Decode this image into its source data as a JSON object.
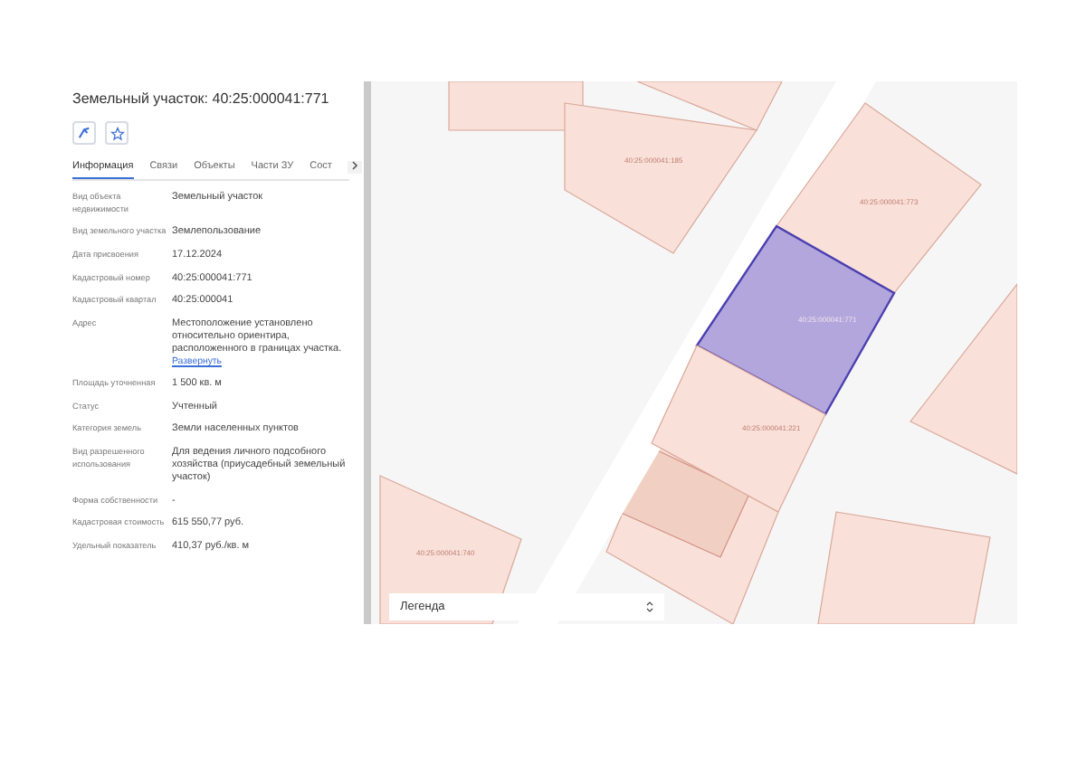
{
  "title": "Земельный участок: 40:25:000041:771",
  "actions": [
    {
      "kind": "locate"
    },
    {
      "kind": "favorite"
    }
  ],
  "tabs": [
    {
      "label": "Информация",
      "selected": true
    },
    {
      "label": "Связи",
      "selected": false
    },
    {
      "label": "Объекты",
      "selected": false
    },
    {
      "label": "Части ЗУ",
      "selected": false
    },
    {
      "label": "Сост",
      "selected": false
    }
  ],
  "fields": [
    {
      "label": "Вид объекта недвижимости",
      "value": "Земельный участок"
    },
    {
      "label": "Вид земельного участка",
      "value": "Землепользование"
    },
    {
      "label": "Дата присвоения",
      "value": "17.12.2024"
    },
    {
      "label": "Кадастровый номер",
      "value": "40:25:000041:771"
    },
    {
      "label": "Кадастровый квартал",
      "value": "40:25:000041"
    },
    {
      "label": "Адрес",
      "value": "Местоположение установлено относительно ориентира, расположенного в границах участка.",
      "link": "Развернуть"
    },
    {
      "label": "Площадь уточненная",
      "value": "1 500 кв. м"
    },
    {
      "label": "Статус",
      "value": "Учтенный"
    },
    {
      "label": "Категория земель",
      "value": "Земли населенных пунктов"
    },
    {
      "label": "Вид разрешенного использования",
      "value": "Для ведения личного подсобного хозяйства (приусадебный земельный участок)"
    },
    {
      "label": "Форма собственности",
      "value": "-"
    },
    {
      "label": "Кадастровая стоимость",
      "value": "615 550,77 руб."
    },
    {
      "label": "Удельный показатель",
      "value": "410,37 руб./кв. м"
    }
  ],
  "map": {
    "parcels": [
      {
        "label": "40:25:000041:185",
        "selected": false
      },
      {
        "label": "40:25:000041:773",
        "selected": false
      },
      {
        "label": "40:25:000041:771",
        "selected": true
      },
      {
        "label": "40:25:000041:221",
        "selected": false
      },
      {
        "label": "40:25:000041:740",
        "selected": false
      }
    ],
    "legend": "Легенда"
  }
}
